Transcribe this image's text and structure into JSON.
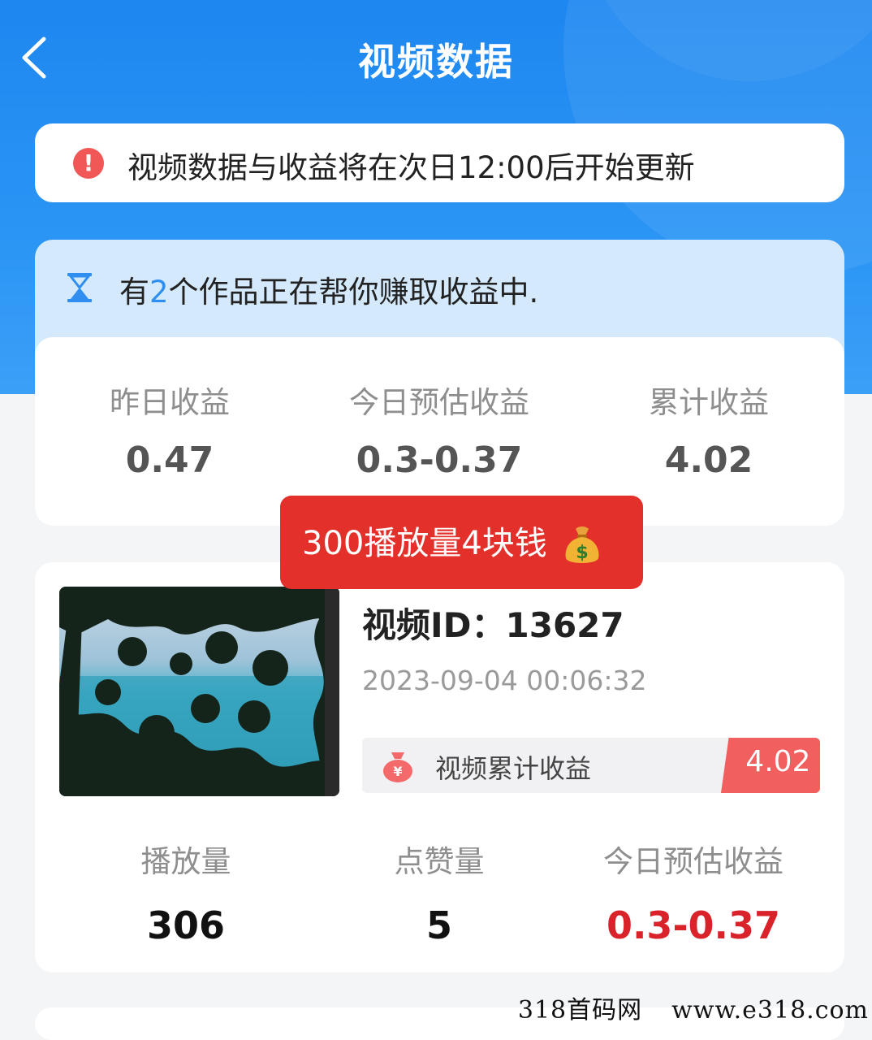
{
  "header": {
    "title": "视频数据"
  },
  "notice": {
    "text": "视频数据与收益将在次日12:00后开始更新"
  },
  "earnings_summary": {
    "prefix": "有",
    "count": "2",
    "suffix": "个作品正在帮你赚取收益中.",
    "stats": [
      {
        "label": "昨日收益",
        "value": "0.47"
      },
      {
        "label": "今日预估收益",
        "value": "0.3-0.37"
      },
      {
        "label": "累计收益",
        "value": "4.02"
      }
    ]
  },
  "promo": {
    "text": "300播放量4块钱"
  },
  "video": {
    "id_label": "视频ID：13627",
    "date": "2023-09-04 00:06:32",
    "earnings_label": "视频累计收益",
    "earnings_value": "4.02",
    "stats": [
      {
        "label": "播放量",
        "value": "306"
      },
      {
        "label": "点赞量",
        "value": "5"
      },
      {
        "label": "今日预估收益",
        "value": "0.3-0.37"
      }
    ]
  },
  "watermark": {
    "left": "318首码网",
    "right": "www.e318.com"
  },
  "colors": {
    "header_blue": "#1e87f0",
    "alert_red": "#f25757",
    "promo_red": "#e3302b",
    "value_red": "#d9222a",
    "accent_blue": "#2f8ef0"
  },
  "icons": [
    "back-chevron-icon",
    "alert-icon",
    "hourglass-icon",
    "money-bag-icon",
    "moneybag-yen-icon"
  ]
}
